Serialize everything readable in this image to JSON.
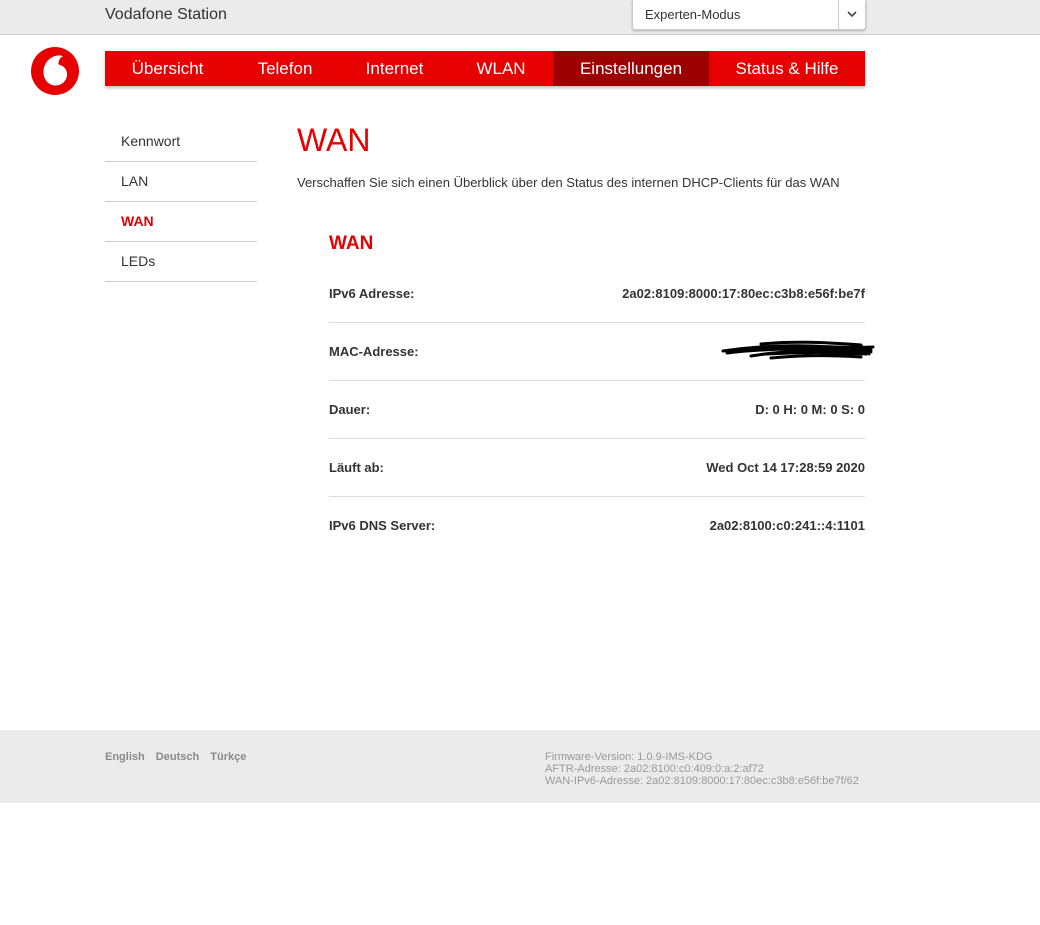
{
  "header": {
    "app_title": "Vodafone Station",
    "mode_select": {
      "value": "Experten-Modus"
    }
  },
  "colors": {
    "brand_red": "#e60000",
    "active_nav": "#9c0000",
    "topbar_bg": "#ebebeb",
    "footer_bg": "#ebebeb"
  },
  "nav": {
    "items": [
      {
        "label": "Übersicht",
        "active": false
      },
      {
        "label": "Telefon",
        "active": false
      },
      {
        "label": "Internet",
        "active": false
      },
      {
        "label": "WLAN",
        "active": false
      },
      {
        "label": "Einstellungen",
        "active": true
      },
      {
        "label": "Status & Hilfe",
        "active": false
      }
    ]
  },
  "sidebar": {
    "items": [
      {
        "label": "Kennwort",
        "active": false
      },
      {
        "label": "LAN",
        "active": false
      },
      {
        "label": "WAN",
        "active": true
      },
      {
        "label": "LEDs",
        "active": false
      }
    ]
  },
  "main": {
    "title": "WAN",
    "description": "Verschaffen Sie sich einen Überblick über den Status des internen DHCP-Clients für das WAN",
    "section_title": "WAN",
    "rows": [
      {
        "label": "IPv6 Adresse:",
        "value": "2a02:8109:8000:17:80ec:c3b8:e56f:be7f"
      },
      {
        "label": "MAC-Adresse:",
        "value": ""
      },
      {
        "label": "Dauer:",
        "value": "D: 0 H: 0 M: 0 S: 0"
      },
      {
        "label": "Läuft ab:",
        "value": "Wed Oct 14 17:28:59 2020"
      },
      {
        "label": "IPv6 DNS Server:",
        "value": "2a02:8100:c0:241::4:1101"
      }
    ]
  },
  "footer": {
    "languages": [
      "English",
      "Deutsch",
      "Türkçe"
    ],
    "firmware": "Firmware-Version: 1.0.9-IMS-KDG",
    "aftr": "AFTR-Adresse: 2a02:8100:c0:409:0:a:2:af72",
    "wan_ipv6": "WAN-IPv6-Adresse: 2a02:8109:8000:17:80ec:c3b8:e56f:be7f/62"
  },
  "icons": {
    "logo": "vodafone-logo",
    "dropdown": "chevron-down-icon",
    "redaction": "scribble-redaction"
  }
}
